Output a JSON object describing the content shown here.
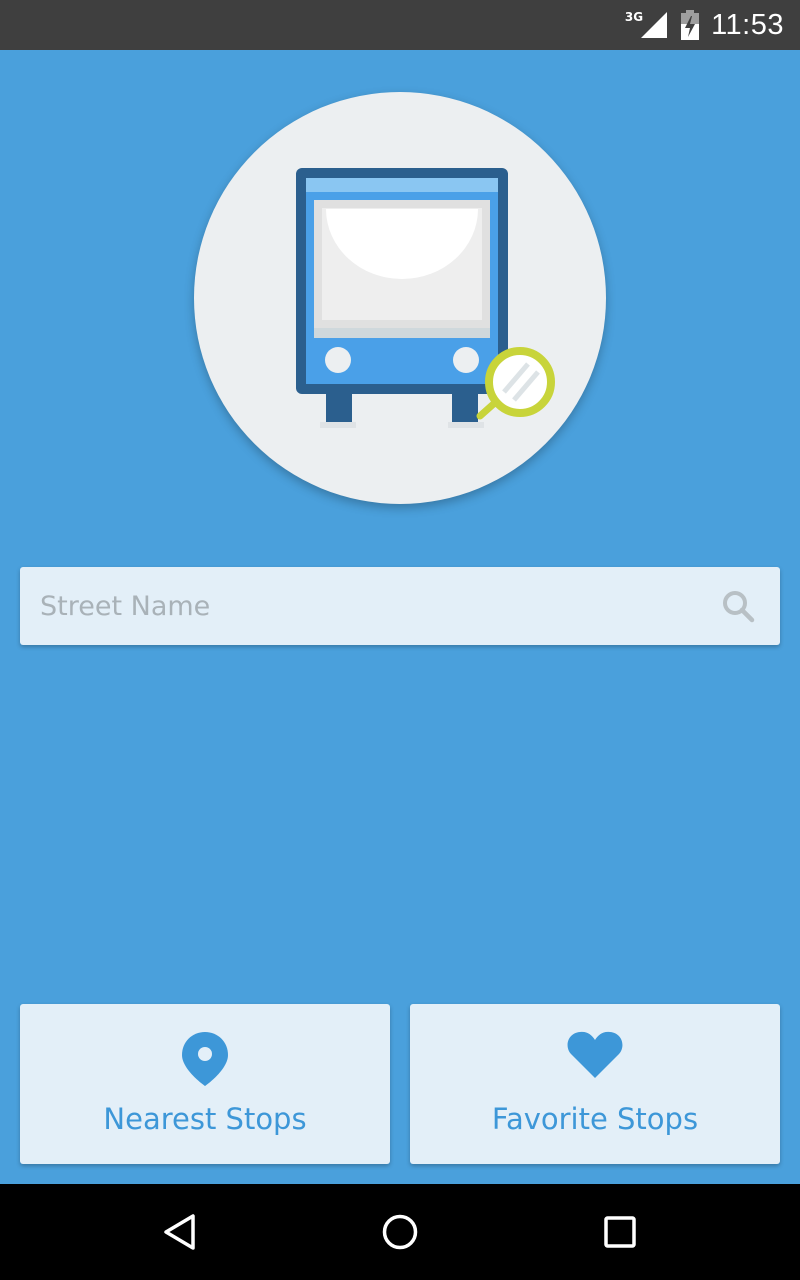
{
  "status_bar": {
    "network_label": "3G",
    "time": "11:53",
    "signal_icon": "cell-signal-icon",
    "battery_icon": "battery-charging-icon"
  },
  "logo": {
    "icon": "bus-search-logo",
    "colors": {
      "circle": "#eceff1",
      "bus_frame": "#2b5f8e",
      "bus_body": "#4aa0e8",
      "windshield": "#eeeeee",
      "magnifier_ring": "#c8d43a"
    }
  },
  "search": {
    "placeholder": "Street Name",
    "value": "",
    "icon": "search-icon"
  },
  "actions": [
    {
      "label": "Nearest Stops",
      "icon": "location-pin-icon"
    },
    {
      "label": "Favorite Stops",
      "icon": "heart-icon"
    }
  ],
  "nav_bar": {
    "buttons": [
      "back-icon",
      "home-icon",
      "recents-icon"
    ]
  },
  "theme": {
    "background": "#4aa0dc",
    "card": "#e3eff8",
    "accent": "#3d97d8"
  }
}
